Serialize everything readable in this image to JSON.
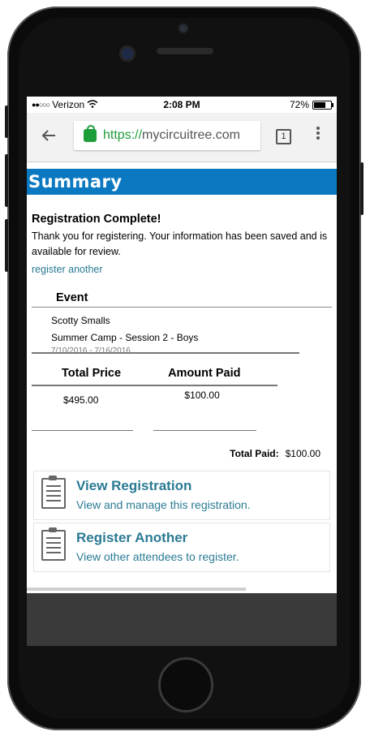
{
  "status": {
    "carrier": "Verizon",
    "time": "2:08 PM",
    "battery": "72%",
    "battery_level": 0.72
  },
  "browser": {
    "url_scheme": "https://",
    "url_host": "mycircuitree.com",
    "tab_count": "1"
  },
  "page": {
    "section_title": "Summary",
    "heading": "Registration Complete!",
    "message": "Thank you for registering. Your information has been saved and is available for review.",
    "register_another_link": "register another"
  },
  "event": {
    "header": "Event",
    "attendee": "Scotty Smalls",
    "session": "Summer Camp - Session 2 - Boys",
    "dates": "7/10/2016 - 7/16/2016"
  },
  "payment": {
    "total_price_label": "Total Price",
    "amount_paid_label": "Amount Paid",
    "total_price": "$495.00",
    "amount_paid": "$100.00",
    "total_paid_label": "Total Paid:",
    "total_paid": "$100.00"
  },
  "actions": [
    {
      "title": "View Registration",
      "subtitle": "View and manage this registration.",
      "icon": "clipboard-icon"
    },
    {
      "title": "Register Another",
      "subtitle": "View other attendees to register.",
      "icon": "clipboard-icon"
    }
  ],
  "colors": {
    "accent": "#0b79c1",
    "link": "#2a7a94",
    "secure": "#1e9e3a"
  }
}
